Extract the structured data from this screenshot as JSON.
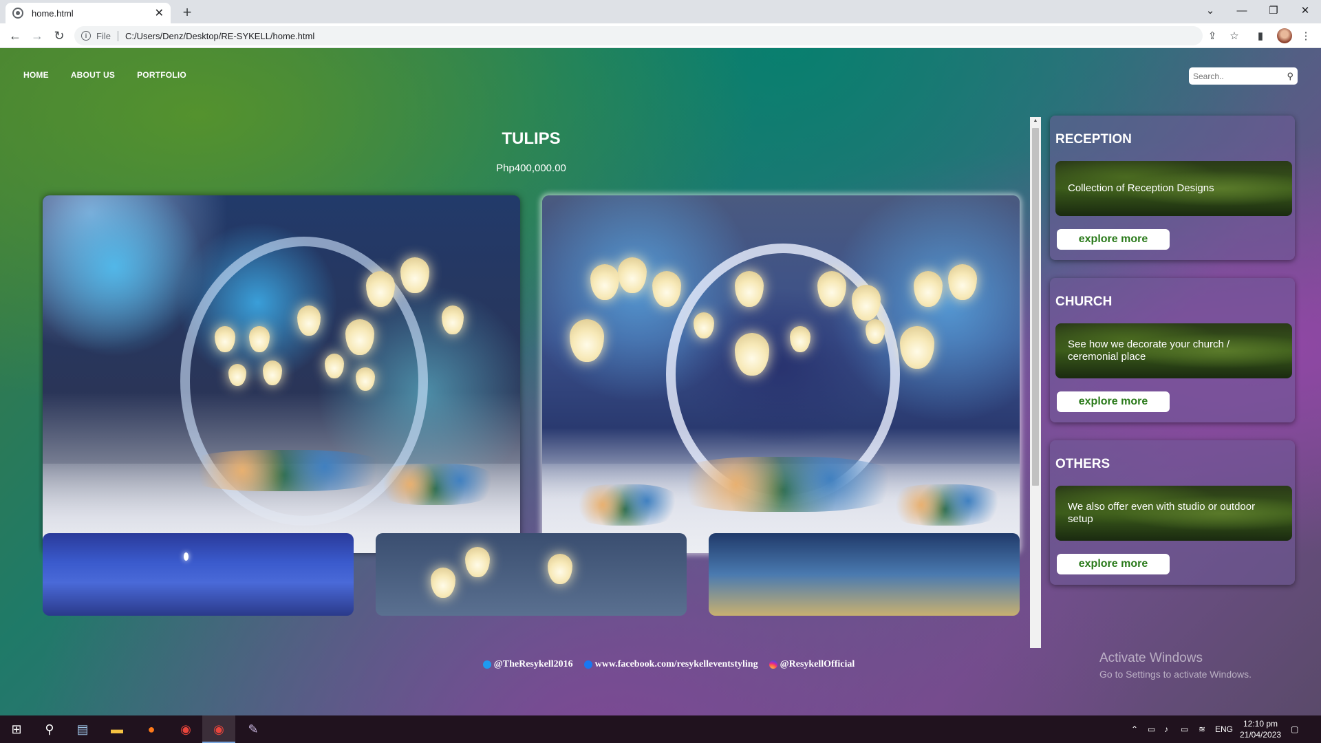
{
  "browser": {
    "tab_title": "home.html",
    "new_tab_label": "+",
    "address_scheme": "File",
    "address_url": "C:/Users/Denz/Desktop/RE-SYKELL/home.html"
  },
  "nav": {
    "items": [
      "HOME",
      "ABOUT US",
      "PORTFOLIO"
    ]
  },
  "search": {
    "placeholder": "Search.."
  },
  "product": {
    "title": "TULIPS",
    "price": "Php400,000.00"
  },
  "sidebar": {
    "cards": [
      {
        "title": "RECEPTION",
        "description": "Collection of Reception Designs",
        "button": "explore more"
      },
      {
        "title": "CHURCH",
        "description": "See how we decorate your church / ceremonial place",
        "button": "explore more"
      },
      {
        "title": "OTHERS",
        "description": "We also offer even with studio or outdoor setup",
        "button": "explore more"
      }
    ]
  },
  "footer": {
    "twitter": "@TheResykell2016",
    "facebook": "www.facebook.com/resykelleventstyling",
    "instagram": "@ResykellOfficial"
  },
  "watermark": {
    "line1": "Activate Windows",
    "line2": "Go to Settings to activate Windows."
  },
  "taskbar": {
    "language": "ENG",
    "time": "12:10 pm",
    "date": "21/04/2023"
  },
  "colors": {
    "button_text": "#2a7a1a",
    "taskbar": "#20121e"
  }
}
